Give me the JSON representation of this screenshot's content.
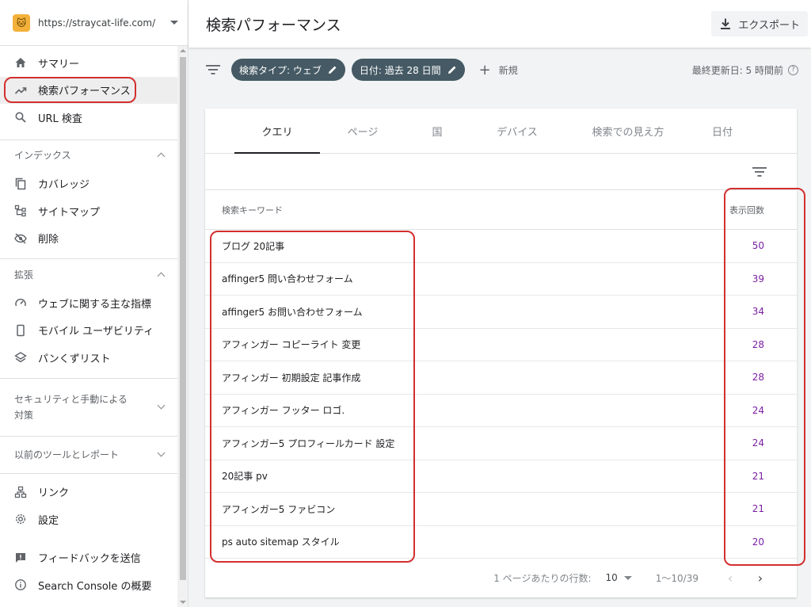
{
  "property": {
    "icon": "cat-icon",
    "url": "https://straycat-life.com/"
  },
  "nav": {
    "summary": "サマリー",
    "performance": "検索パフォーマンス",
    "url_inspection": "URL 検査",
    "index_section": "インデックス",
    "coverage": "カバレッジ",
    "sitemaps": "サイトマップ",
    "removals": "削除",
    "enhancements_section": "拡張",
    "web_vitals": "ウェブに関する主な指標",
    "mobile_usability": "モバイル ユーザビリティ",
    "breadcrumbs": "パンくずリスト",
    "security_section": "セキュリティと手動による対策",
    "legacy_section": "以前のツールとレポート",
    "links": "リンク",
    "settings": "設定",
    "feedback": "フィードバックを送信",
    "about": "Search Console の概要"
  },
  "header": {
    "title": "検索パフォーマンス",
    "export_label": "エクスポート"
  },
  "filters": {
    "search_type": "検索タイプ: ウェブ",
    "date": "日付: 過去 28 日間",
    "new_label": "新規",
    "last_updated": "最終更新日: 5 時間前"
  },
  "tabs": [
    "クエリ",
    "ページ",
    "国",
    "デバイス",
    "検索での見え方",
    "日付"
  ],
  "table": {
    "col_query": "検索キーワード",
    "col_impressions": "表示回数",
    "rows": [
      {
        "query": "ブログ 20記事",
        "impressions": "50"
      },
      {
        "query": "affinger5 問い合わせフォーム",
        "impressions": "39"
      },
      {
        "query": "affinger5 お問い合わせフォーム",
        "impressions": "34"
      },
      {
        "query": "アフィンガー コピーライト 変更",
        "impressions": "28"
      },
      {
        "query": "アフィンガー 初期設定 記事作成",
        "impressions": "28"
      },
      {
        "query": "アフィンガー フッター ロゴ.",
        "impressions": "24"
      },
      {
        "query": "アフィンガー5 プロフィールカード 設定",
        "impressions": "24"
      },
      {
        "query": "20記事 pv",
        "impressions": "21"
      },
      {
        "query": "アフィンガー5 ファビコン",
        "impressions": "21"
      },
      {
        "query": "ps auto sitemap スタイル",
        "impressions": "20"
      }
    ]
  },
  "pager": {
    "rows_per_page_label": "1 ページあたりの行数:",
    "rows_per_page": "10",
    "range": "1～10/39",
    "prev": "‹",
    "next": "›"
  },
  "colors": {
    "chip_bg": "#455a64",
    "value_purple": "#7b1fa2",
    "annotation_red": "#d32f2f"
  }
}
